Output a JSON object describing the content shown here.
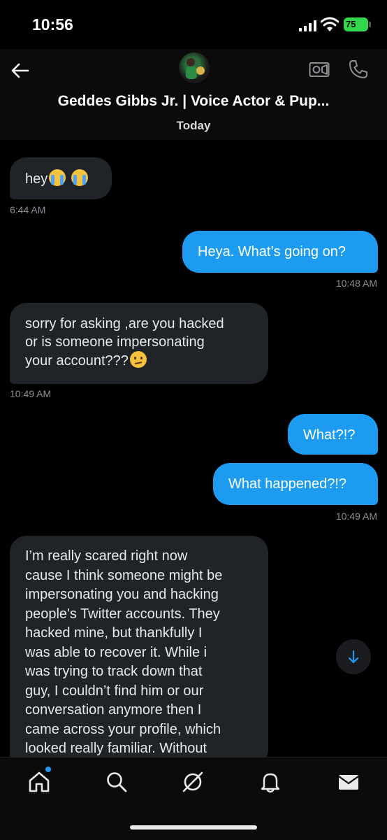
{
  "status_bar": {
    "time": "10:56",
    "battery": "75"
  },
  "header": {
    "title": "Geddes Gibbs Jr. | Voice Actor & Pup...",
    "day_label": "Today"
  },
  "messages": [
    {
      "direction": "in",
      "text": "hey",
      "emoji": [
        "loudly-crying-face",
        "loudly-crying-face"
      ],
      "time": "6:44 AM"
    },
    {
      "direction": "out",
      "text": "Heya. What’s going on?",
      "time": "10:48 AM"
    },
    {
      "direction": "in",
      "lines": [
        "sorry for asking ,are you hacked",
        "or is someone impersonating",
        "your account???"
      ],
      "emoji": [
        "confused-face"
      ],
      "time": "10:49 AM"
    },
    {
      "direction": "out",
      "text": "What?!?"
    },
    {
      "direction": "out",
      "text": "What happened?!?",
      "time": "10:49 AM"
    },
    {
      "direction": "in",
      "lines": [
        "I’m really scared right now",
        "cause I think someone might be",
        "impersonating you and hacking",
        "people's Twitter accounts. They",
        "hacked mine, but thankfully I",
        "was able to recover it. While i",
        "was trying to track down that",
        "guy, I couldn’t find him or our",
        "conversation anymore then I",
        "came across your profile, which",
        "looked really familiar. Without"
      ]
    }
  ],
  "nav": [
    "home-icon",
    "search-icon",
    "grok-icon",
    "notifications-bell-icon",
    "messages-envelope-icon"
  ],
  "colors": {
    "accent": "#1d9bf0",
    "incoming_bubble": "#202327",
    "battery": "#32d74b"
  }
}
